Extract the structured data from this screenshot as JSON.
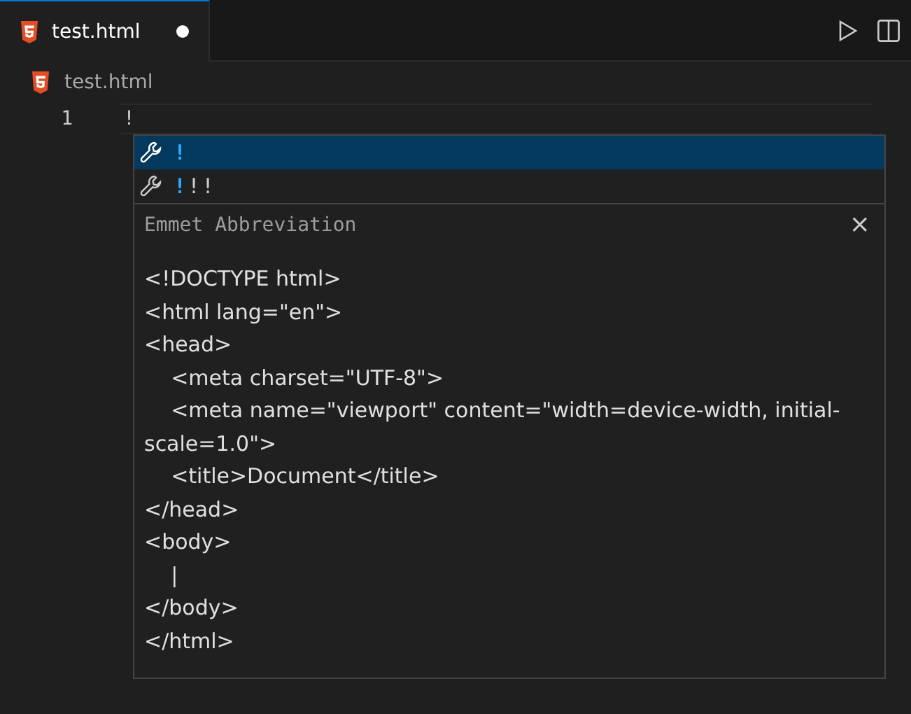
{
  "tabs": [
    {
      "label": "test.html",
      "selected": true,
      "dirty": true
    }
  ],
  "breadcrumb": {
    "file": "test.html"
  },
  "editor": {
    "lines": [
      {
        "number": "1",
        "text": "!"
      }
    ]
  },
  "suggestions": [
    {
      "label": "**!**",
      "selected": true
    },
    {
      "label": "**!**!!",
      "selected": false
    }
  ],
  "details": {
    "title": "Emmet Abbreviation",
    "close": "×",
    "code": [
      "<!DOCTYPE html>",
      "<html lang=\"en\">",
      "<head>",
      "\t<meta charset=\"UTF-8\">",
      "\t<meta name=\"viewport\" content=\"width=device-width, initial-scale=1.0\">",
      "\t<title>Document</title>",
      "</head>",
      "<body>",
      "\t|",
      "</body>",
      "</html>"
    ]
  }
}
